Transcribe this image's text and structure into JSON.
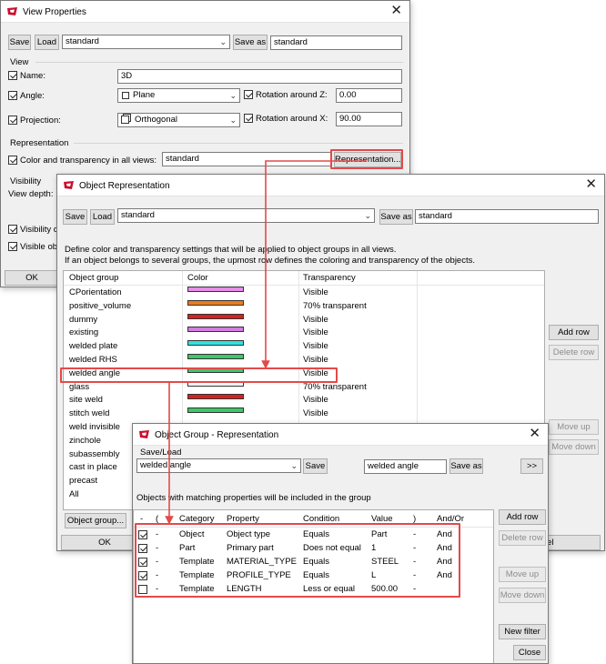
{
  "colors": {
    "accent_red": "#e34a4a",
    "logo_red": "#c8102e"
  },
  "view_properties": {
    "title": "View Properties",
    "save": "Save",
    "load": "Load",
    "preset": "standard",
    "save_as": "Save as",
    "save_as_value": "standard",
    "section_view": "View",
    "name_label": "Name:",
    "name_value": "3D",
    "angle_label": "Angle:",
    "angle_value": "Plane",
    "rot_z_label": "Rotation around Z:",
    "rot_z_value": "0.00",
    "projection_label": "Projection:",
    "projection_value": "Orthogonal",
    "rot_x_label": "Rotation around X:",
    "rot_x_value": "90.00",
    "section_representation": "Representation",
    "color_transparency_label": "Color and transparency in all views:",
    "color_transparency_value": "standard",
    "representation_button": "Representation...",
    "section_visibility": "Visibility",
    "view_depth_label": "View depth:",
    "visibility_of_label": "Visibility o",
    "visible_obj_label": "Visible obj",
    "ok": "OK"
  },
  "object_representation": {
    "title": "Object Representation",
    "save": "Save",
    "load": "Load",
    "preset": "standard",
    "save_as": "Save as",
    "save_as_value": "standard",
    "desc1": "Define color and transparency settings that will be applied to object groups in all views.",
    "desc2": "If an object belongs to several groups, the upmost row defines the coloring and transparency of the objects.",
    "headers": {
      "group": "Object group",
      "color": "Color",
      "transparency": "Transparency"
    },
    "rows": [
      {
        "group": "CPorientation",
        "color": "#e48fe6",
        "transparency": "Visible"
      },
      {
        "group": "positive_volume",
        "color": "#e87d1e",
        "transparency": "70% transparent"
      },
      {
        "group": "dummy",
        "color": "#d92020",
        "transparency": "Visible"
      },
      {
        "group": "existing",
        "color": "#d27ee0",
        "transparency": "Visible"
      },
      {
        "group": "welded plate",
        "color": "#33e0e0",
        "transparency": "Visible"
      },
      {
        "group": "welded RHS",
        "color": "#3fc66a",
        "transparency": "Visible"
      },
      {
        "group": "welded angle",
        "color": "#3fc66a",
        "transparency": "Visible"
      },
      {
        "group": "glass",
        "color": "#ffffff",
        "transparency": "70% transparent"
      },
      {
        "group": "site weld",
        "color": "#d92020",
        "transparency": "Visible"
      },
      {
        "group": "stitch weld",
        "color": "#3fc66a",
        "transparency": "Visible"
      },
      {
        "group": "weld invisible",
        "color": "",
        "transparency": ""
      },
      {
        "group": "zinchole",
        "color": "",
        "transparency": ""
      },
      {
        "group": "subassembly",
        "color": "",
        "transparency": ""
      },
      {
        "group": "cast in place",
        "color": "",
        "transparency": ""
      },
      {
        "group": "precast",
        "color": "",
        "transparency": ""
      },
      {
        "group": "All",
        "color": "",
        "transparency": ""
      }
    ],
    "add_row": "Add row",
    "delete_row": "Delete row",
    "move_up": "Move up",
    "move_down": "Move down",
    "object_group_button": "Object group...",
    "ok": "OK",
    "cancel_partial": "ncel"
  },
  "object_group": {
    "title": "Object Group - Representation",
    "save_load_label": "Save/Load",
    "preset": "welded angle",
    "save": "Save",
    "save_as_value": "welded angle",
    "save_as": "Save as",
    "more": ">>",
    "desc": "Objects with matching properties will be included in the group",
    "headers": {
      "dash": "-",
      "open": "(",
      "category": "Category",
      "property": "Property",
      "condition": "Condition",
      "value": "Value",
      "close": ")",
      "andor": "And/Or"
    },
    "rules": [
      {
        "checked": true,
        "dash": "-",
        "category": "Object",
        "property": "Object type",
        "condition": "Equals",
        "value": "Part",
        "close": "-",
        "andor": "And"
      },
      {
        "checked": true,
        "dash": "-",
        "category": "Part",
        "property": "Primary part",
        "condition": "Does not equal",
        "value": "1",
        "close": "-",
        "andor": "And"
      },
      {
        "checked": true,
        "dash": "-",
        "category": "Template",
        "property": "MATERIAL_TYPE",
        "condition": "Equals",
        "value": "STEEL",
        "close": "-",
        "andor": "And"
      },
      {
        "checked": true,
        "dash": "-",
        "category": "Template",
        "property": "PROFILE_TYPE",
        "condition": "Equals",
        "value": "L",
        "close": "-",
        "andor": "And"
      },
      {
        "checked": false,
        "dash": "-",
        "category": "Template",
        "property": "LENGTH",
        "condition": "Less or equal",
        "value": "500.00",
        "close": "-",
        "andor": ""
      }
    ],
    "add_row": "Add row",
    "delete_row": "Delete row",
    "move_up": "Move up",
    "move_down": "Move down",
    "new_filter": "New filter",
    "close": "Close"
  }
}
